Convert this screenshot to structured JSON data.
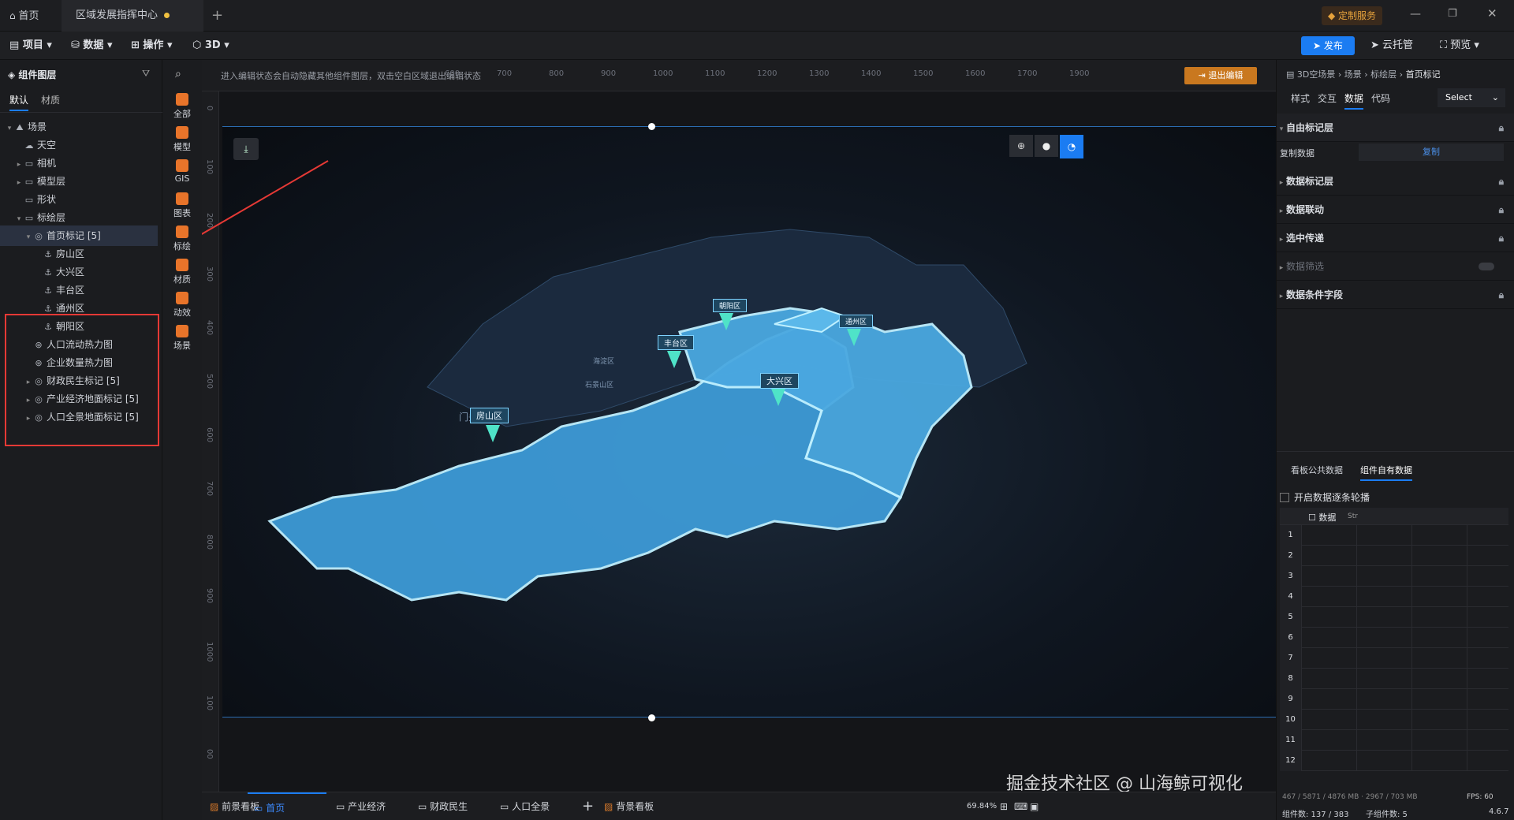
{
  "tabs": [
    {
      "label": "首页"
    },
    {
      "label": "区域发展指挥中心"
    }
  ],
  "topbar": {
    "custom_service": "定制服务",
    "window_controls": [
      "minimize-icon",
      "restore-icon",
      "close-icon"
    ]
  },
  "menu": {
    "items": [
      "项目",
      "数据",
      "操作",
      "3D"
    ],
    "publish": "发布",
    "cloud": "云托管",
    "preview": "预览"
  },
  "left_panel": {
    "title": "组件图层",
    "tabs": [
      "默认",
      "材质"
    ],
    "tree": [
      {
        "label": "场景",
        "level": 0,
        "expanded": true,
        "icon": "scene-icon"
      },
      {
        "label": "天空",
        "level": 1,
        "icon": "cloud-icon"
      },
      {
        "label": "相机",
        "level": 1,
        "collapsed": true,
        "icon": "folder-icon"
      },
      {
        "label": "模型层",
        "level": 1,
        "collapsed": true,
        "icon": "folder-icon"
      },
      {
        "label": "形状",
        "level": 1,
        "icon": "folder-icon"
      },
      {
        "label": "标绘层",
        "level": 1,
        "expanded": true,
        "icon": "folder-icon"
      },
      {
        "label": "首页标记 [5]",
        "level": 2,
        "expanded": true,
        "selected": true,
        "icon": "marker-icon"
      },
      {
        "label": "房山区",
        "level": 3,
        "icon": "anchor-icon"
      },
      {
        "label": "大兴区",
        "level": 3,
        "icon": "anchor-icon"
      },
      {
        "label": "丰台区",
        "level": 3,
        "icon": "anchor-icon"
      },
      {
        "label": "通州区",
        "level": 3,
        "icon": "anchor-icon"
      },
      {
        "label": "朝阳区",
        "level": 3,
        "icon": "anchor-icon"
      },
      {
        "label": "人口流动热力图",
        "level": 2,
        "icon": "heatmap-icon"
      },
      {
        "label": "企业数量热力图",
        "level": 2,
        "icon": "heatmap-icon"
      },
      {
        "label": "财政民生标记 [5]",
        "level": 2,
        "collapsed": true,
        "icon": "marker-icon"
      },
      {
        "label": "产业经济地面标记 [5]",
        "level": 2,
        "collapsed": true,
        "icon": "marker-icon"
      },
      {
        "label": "人口全景地面标记 [5]",
        "level": 2,
        "collapsed": true,
        "icon": "marker-icon"
      }
    ]
  },
  "rail": [
    {
      "label": "全部",
      "color": "#e8742a"
    },
    {
      "label": "模型",
      "color": "#e8742a"
    },
    {
      "label": "GIS",
      "color": "#e8742a"
    },
    {
      "label": "图表",
      "color": "#e8742a"
    },
    {
      "label": "标绘",
      "color": "#e8742a"
    },
    {
      "label": "材质",
      "color": "#e8742a"
    },
    {
      "label": "动效",
      "color": "#e8742a"
    },
    {
      "label": "场景",
      "color": "#e8742a"
    }
  ],
  "canvas": {
    "hint": "进入编辑状态会自动隐藏其他组件图层，双击空白区域退出编辑状态",
    "exit_edit": "退出编辑",
    "ruler_top": [
      "600",
      "700",
      "800",
      "900",
      "1000",
      "1100",
      "1200",
      "1300",
      "1400",
      "1500",
      "1600",
      "1700",
      "1900"
    ],
    "ruler_left": [
      "0",
      "100",
      "200",
      "300",
      "400",
      "500",
      "600",
      "700",
      "800",
      "900",
      "1000",
      "100",
      "00"
    ],
    "map_labels": [
      "门头沟区",
      "海淀区",
      "石景山区"
    ],
    "markers": [
      "房山区",
      "丰台区",
      "大兴区",
      "朝阳区",
      "通州区"
    ]
  },
  "right_panel": {
    "breadcrumb": [
      "3D空场景",
      "场景",
      "标绘层",
      "首页标记"
    ],
    "tabs": [
      "样式",
      "交互",
      "数据",
      "代码"
    ],
    "active_tab": "数据",
    "select": "Select",
    "sections": [
      {
        "label": "自由标记层",
        "expanded": true
      },
      {
        "label": "数据标记层"
      },
      {
        "label": "数据联动"
      },
      {
        "label": "选中传递"
      },
      {
        "label": "数据筛选",
        "disabled": true
      },
      {
        "label": "数据条件字段"
      }
    ],
    "copy_label": "复制数据",
    "copy_button": "复制",
    "data_tabs": [
      "看板公共数据",
      "组件自有数据"
    ],
    "carousel_label": "开启数据逐条轮播",
    "grid_header": "数据",
    "grid_header_type": "Str",
    "grid_rows": [
      "1",
      "2",
      "3",
      "4",
      "5",
      "6",
      "7",
      "8",
      "9",
      "10",
      "11",
      "12"
    ]
  },
  "bottom_bar": {
    "tabs": [
      {
        "label": "前景看板"
      },
      {
        "label": "首页",
        "active": true
      },
      {
        "label": "产业经济"
      },
      {
        "label": "财政民生"
      },
      {
        "label": "人口全景"
      },
      {
        "label": "背景看板"
      }
    ],
    "zoom": "69.84%",
    "stats_top": "FPS: 60",
    "stats_mid": "467 / 5871 / 4876 MB · 2967 / 703 MB",
    "component_count": "组件数: 137 / 383",
    "sub_component_count": "子组件数: 5",
    "version": "4.6.7"
  },
  "watermark": "掘金技术社区 @ 山海鲸可视化",
  "colors": {
    "accent": "#1b7cf2",
    "selection_box": "#e53935",
    "exit_btn": "#c9781f",
    "region_fill": "#3d9ad6"
  }
}
